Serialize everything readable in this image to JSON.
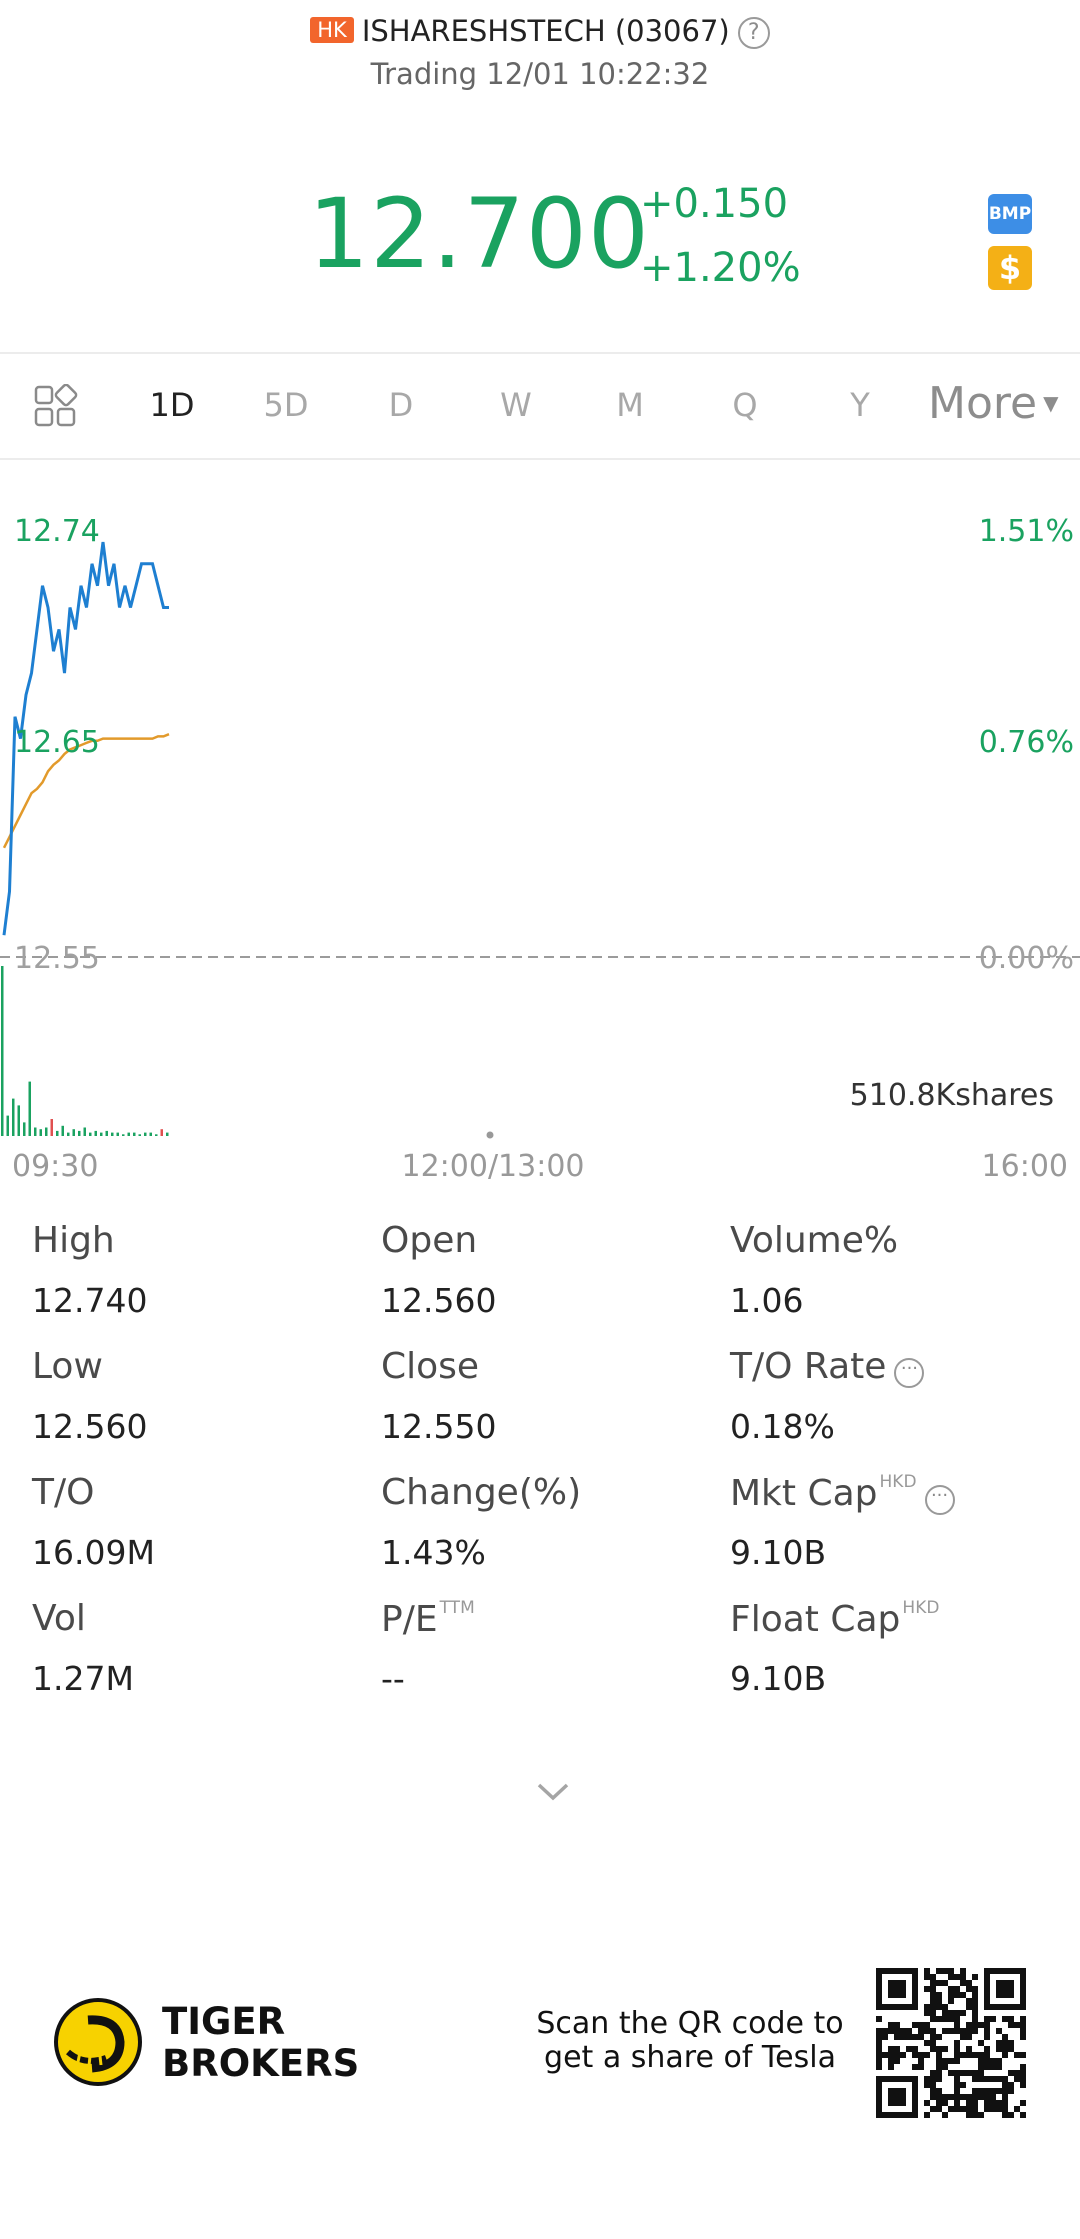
{
  "header": {
    "market_badge": "HK",
    "symbol": "ISHARESHSTECH (03067)",
    "help_glyph": "?",
    "status": "Trading 12/01 10:22:32"
  },
  "quote": {
    "price": "12.700",
    "change": "+0.150",
    "change_pct": "+1.20%",
    "bmp_label": "BMP",
    "dollar_label": "$",
    "up_color": "#1aa260"
  },
  "periods": {
    "tabs": [
      "1D",
      "5D",
      "D",
      "W",
      "M",
      "Q",
      "Y"
    ],
    "active": "1D",
    "more": "More"
  },
  "chart_data": {
    "type": "line",
    "price_axis_labels": [
      "12.74",
      "12.65",
      "12.55"
    ],
    "percent_axis_labels": [
      "1.51%",
      "0.76%",
      "0.00%"
    ],
    "time_labels": [
      "09:30",
      "12:00/13:00",
      "16:00"
    ],
    "volume_label": "510.8Kshares",
    "ylim": [
      12.55,
      12.74
    ],
    "prev_close": 12.55,
    "series": [
      {
        "color": "#1e7fd1",
        "x": [
          0,
          1,
          2,
          3,
          4,
          5,
          6,
          7,
          8,
          9,
          10,
          11,
          12,
          13,
          14,
          15,
          16,
          17,
          18,
          19,
          20,
          21,
          22,
          23,
          24,
          25,
          26,
          27,
          28,
          29,
          30
        ],
        "values": [
          12.56,
          12.58,
          12.66,
          12.65,
          12.67,
          12.68,
          12.7,
          12.72,
          12.71,
          12.69,
          12.7,
          12.68,
          12.71,
          12.7,
          12.72,
          12.71,
          12.73,
          12.72,
          12.74,
          12.72,
          12.73,
          12.71,
          12.72,
          12.71,
          12.72,
          12.73,
          12.73,
          12.73,
          12.72,
          12.71,
          12.71
        ]
      },
      {
        "color": "#e29a2b",
        "x": [
          0,
          1,
          2,
          3,
          4,
          5,
          6,
          7,
          8,
          9,
          10,
          11,
          12,
          13,
          14,
          15,
          16,
          17,
          18,
          19,
          20,
          21,
          22,
          23,
          24,
          25,
          26,
          27,
          28,
          29,
          30
        ],
        "values": [
          12.6,
          12.605,
          12.61,
          12.615,
          12.62,
          12.625,
          12.627,
          12.63,
          12.635,
          12.638,
          12.64,
          12.643,
          12.645,
          12.646,
          12.647,
          12.648,
          12.649,
          12.649,
          12.65,
          12.65,
          12.65,
          12.65,
          12.65,
          12.65,
          12.65,
          12.65,
          12.65,
          12.65,
          12.651,
          12.651,
          12.652
        ]
      }
    ],
    "volume": [
      {
        "v": 1.0,
        "c": "#1aa260"
      },
      {
        "v": 0.12,
        "c": "#1aa260"
      },
      {
        "v": 0.22,
        "c": "#1aa260"
      },
      {
        "v": 0.18,
        "c": "#1aa260"
      },
      {
        "v": 0.08,
        "c": "#1aa260"
      },
      {
        "v": 0.32,
        "c": "#1aa260"
      },
      {
        "v": 0.05,
        "c": "#1aa260"
      },
      {
        "v": 0.04,
        "c": "#1aa260"
      },
      {
        "v": 0.05,
        "c": "#1aa260"
      },
      {
        "v": 0.1,
        "c": "#e05050"
      },
      {
        "v": 0.03,
        "c": "#1aa260"
      },
      {
        "v": 0.06,
        "c": "#1aa260"
      },
      {
        "v": 0.02,
        "c": "#1aa260"
      },
      {
        "v": 0.04,
        "c": "#1aa260"
      },
      {
        "v": 0.03,
        "c": "#1aa260"
      },
      {
        "v": 0.05,
        "c": "#1aa260"
      },
      {
        "v": 0.02,
        "c": "#1aa260"
      },
      {
        "v": 0.03,
        "c": "#1aa260"
      },
      {
        "v": 0.02,
        "c": "#1aa260"
      },
      {
        "v": 0.03,
        "c": "#1aa260"
      },
      {
        "v": 0.02,
        "c": "#1aa260"
      },
      {
        "v": 0.02,
        "c": "#1aa260"
      },
      {
        "v": 0.01,
        "c": "#1aa260"
      },
      {
        "v": 0.02,
        "c": "#1aa260"
      },
      {
        "v": 0.02,
        "c": "#1aa260"
      },
      {
        "v": 0.01,
        "c": "#1aa260"
      },
      {
        "v": 0.02,
        "c": "#1aa260"
      },
      {
        "v": 0.02,
        "c": "#1aa260"
      },
      {
        "v": 0.01,
        "c": "#1aa260"
      },
      {
        "v": 0.04,
        "c": "#e05050"
      },
      {
        "v": 0.02,
        "c": "#1aa260"
      }
    ],
    "total_slots": 330
  },
  "stats": {
    "high_label": "High",
    "high": "12.740",
    "open_label": "Open",
    "open": "12.560",
    "volpct_label": "Volume%",
    "volpct": "1.06",
    "low_label": "Low",
    "low": "12.560",
    "close_label": "Close",
    "close": "12.550",
    "torate_label": "T/O Rate",
    "torate": "0.18%",
    "to_label": "T/O",
    "to": "16.09M",
    "changepct_label": "Change(%)",
    "changepct": "1.43%",
    "mktcap_label": "Mkt Cap",
    "mktcap_sup": "HKD",
    "mktcap": "9.10B",
    "vol_label": "Vol",
    "vol": "1.27M",
    "pe_label": "P/E",
    "pe_sup": "TTM",
    "pe": "--",
    "floatcap_label": "Float Cap",
    "floatcap_sup": "HKD",
    "floatcap": "9.10B"
  },
  "footer": {
    "brand_line1": "TIGER",
    "brand_line2": "BROKERS",
    "promo_line1": "Scan the QR code to",
    "promo_line2": "get a share of Tesla"
  }
}
